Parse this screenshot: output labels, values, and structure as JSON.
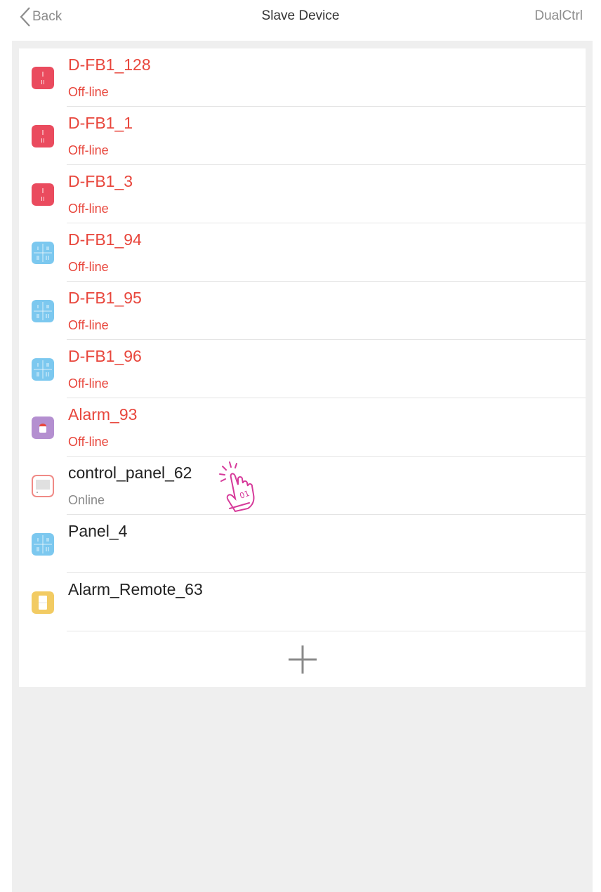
{
  "header": {
    "back_label": "Back",
    "title": "Slave Device",
    "right_action": "DualCtrl"
  },
  "devices": [
    {
      "name": "D-FB1_128",
      "status": "Off-line",
      "icon": "red-single-switch-icon"
    },
    {
      "name": "D-FB1_1",
      "status": "Off-line",
      "icon": "red-single-switch-icon"
    },
    {
      "name": "D-FB1_3",
      "status": "Off-line",
      "icon": "red-single-switch-icon"
    },
    {
      "name": "D-FB1_94",
      "status": "Off-line",
      "icon": "blue-quad-switch-icon"
    },
    {
      "name": "D-FB1_95",
      "status": "Off-line",
      "icon": "blue-quad-switch-icon"
    },
    {
      "name": "D-FB1_96",
      "status": "Off-line",
      "icon": "blue-quad-switch-icon"
    },
    {
      "name": "Alarm_93",
      "status": "Off-line",
      "icon": "purple-alarm-icon"
    },
    {
      "name": "control_panel_62",
      "status": "Online",
      "icon": "control-panel-icon"
    },
    {
      "name": "Panel_4",
      "status": "",
      "icon": "blue-quad-switch-icon"
    },
    {
      "name": "Alarm_Remote_63",
      "status": "",
      "icon": "yellow-remote-icon"
    }
  ],
  "tap_hint": {
    "label": "01"
  },
  "colors": {
    "offline": "#e8463c",
    "online_name": "#222222",
    "online_status": "#8a8a8a",
    "red_icon": "#ea4b5e",
    "blue_icon": "#7cc8ef",
    "purple_icon": "#b48fd0",
    "yellow_icon": "#f2cb63",
    "hint": "#d63a9a"
  }
}
